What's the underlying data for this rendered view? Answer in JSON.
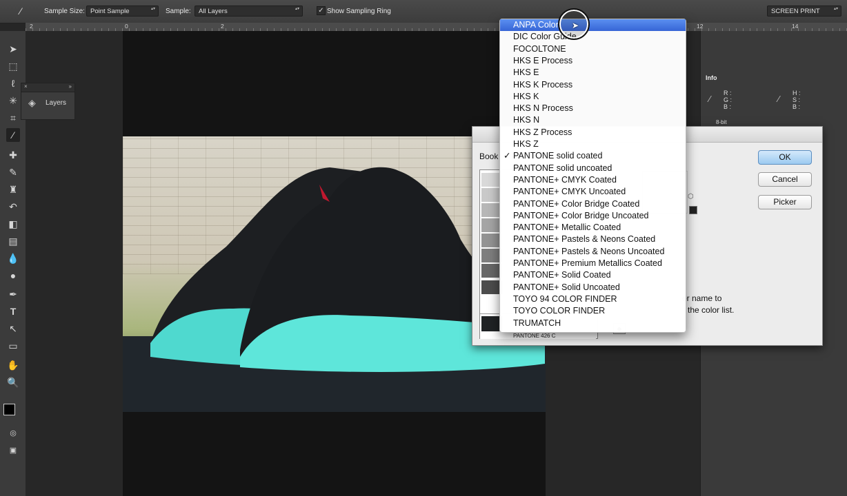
{
  "options_bar": {
    "sample_size_label": "Sample Size:",
    "sample_size_value": "Point Sample",
    "sample_label": "Sample:",
    "sample_value": "All Layers",
    "show_sampling_ring_label": "Show Sampling Ring",
    "show_sampling_ring_checked": true,
    "workspace_value": "SCREEN PRINT"
  },
  "ruler": {
    "ticks": [
      "2",
      "0",
      "2",
      "12",
      "14"
    ]
  },
  "layers_panel": {
    "title": "Layers"
  },
  "info_panel": {
    "title": "Info",
    "rgb_labels": [
      "R :",
      "G :",
      "B :"
    ],
    "hsb_labels": [
      "H :",
      "S :",
      "B :"
    ],
    "bit_depth": "8-bit"
  },
  "dialog": {
    "book_label": "Book",
    "ok_label": "OK",
    "cancel_label": "Cancel",
    "picker_label": "Picker",
    "selected_swatch_name": "PANTONE 426 C",
    "hint_line1": "or name to",
    "hint_line2": "the color list."
  },
  "book_menu": {
    "highlighted_item": "ANPA Color",
    "checked_item": "PANTONE solid coated",
    "items": [
      "ANPA Color",
      "DIC Color Guide",
      "FOCOLTONE",
      "HKS E Process",
      "HKS E",
      "HKS K Process",
      "HKS K",
      "HKS N Process",
      "HKS N",
      "HKS Z Process",
      "HKS Z",
      "PANTONE solid coated",
      "PANTONE solid uncoated",
      "PANTONE+ CMYK Coated",
      "PANTONE+ CMYK Uncoated",
      "PANTONE+ Color Bridge Coated",
      "PANTONE+ Color Bridge Uncoated",
      "PANTONE+ Metallic Coated",
      "PANTONE+ Pastels & Neons Coated",
      "PANTONE+ Pastels & Neons Uncoated",
      "PANTONE+ Premium Metallics Coated",
      "PANTONE+ Solid Coated",
      "PANTONE+ Solid Uncoated",
      "TOYO 94 COLOR FINDER",
      "TOYO COLOR FINDER",
      "TRUMATCH"
    ]
  },
  "tools": [
    "move-icon",
    "marquee-icon",
    "lasso-icon",
    "quick-select-icon",
    "crop-icon",
    "eyedropper-icon",
    "healing-icon",
    "brush-icon",
    "stamp-icon",
    "history-brush-icon",
    "eraser-icon",
    "gradient-icon",
    "blur-icon",
    "dodge-icon",
    "pen-icon",
    "type-icon",
    "path-select-icon",
    "shape-icon",
    "hand-icon",
    "zoom-icon"
  ],
  "colors": {
    "accent": "#3765d6",
    "foreground": "#000000",
    "background": "#ffffff"
  }
}
